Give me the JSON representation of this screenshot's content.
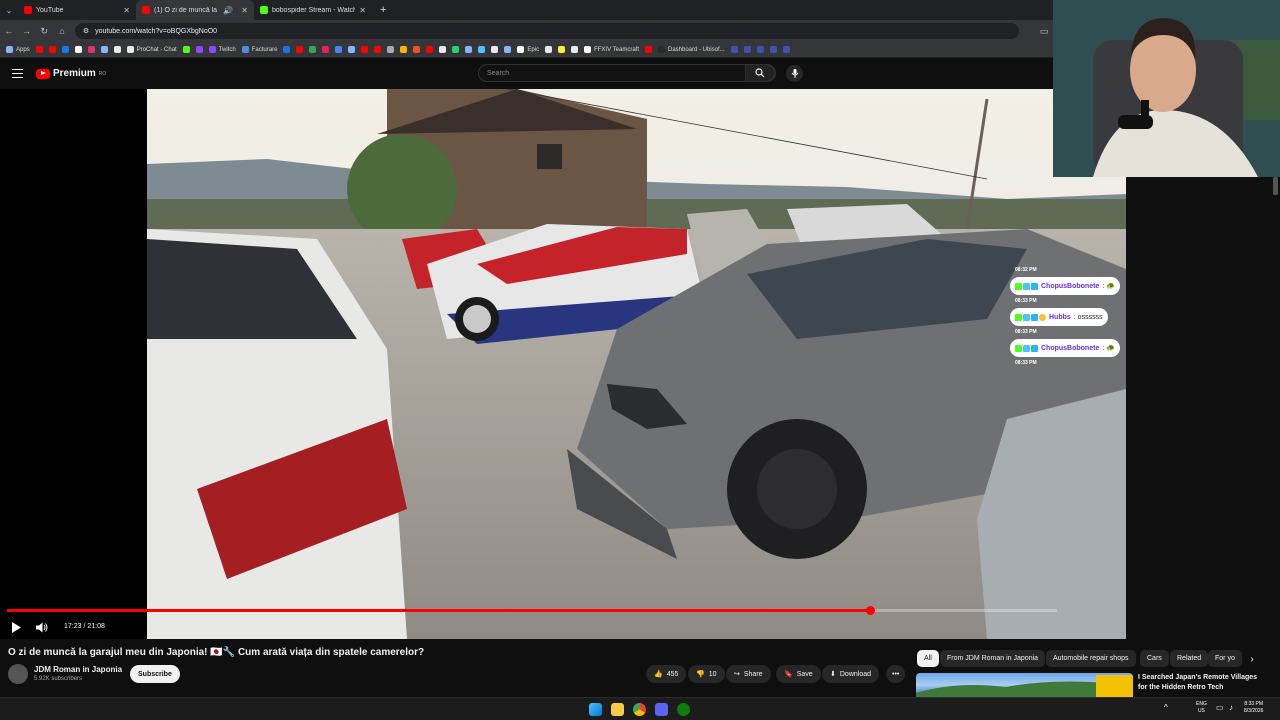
{
  "browser": {
    "tabs": [
      {
        "label": "YouTube",
        "active": false,
        "favicon_color": "#ff0000"
      },
      {
        "label": "(1) O zi de muncă la garajul",
        "active": true,
        "favicon_color": "#ff0000"
      },
      {
        "label": "bobospider Stream - Watch Liv",
        "active": false,
        "favicon_color": "#53fc18"
      }
    ],
    "url": "youtube.com/watch?v=oBQGXbgNoO0",
    "bookmarks": [
      {
        "label": "Apps",
        "color": "#8ab4f8"
      },
      {
        "label": "",
        "color": "#ff0000"
      },
      {
        "label": "",
        "color": "#ff0000"
      },
      {
        "label": "",
        "color": "#1877f2"
      },
      {
        "label": "",
        "color": "#ffffff"
      },
      {
        "label": "",
        "color": "#e1306c"
      },
      {
        "label": "",
        "color": "#8ab4f8"
      },
      {
        "label": "ProChat - Chat",
        "color": "#e8eaed"
      },
      {
        "label": "",
        "color": "#53fc18"
      },
      {
        "label": "Twitch",
        "color": "#9146ff"
      },
      {
        "label": "Facturare",
        "color": "#4a90e2"
      },
      {
        "label": "",
        "color": "#1a73e8"
      },
      {
        "label": "",
        "color": "#ff0000"
      },
      {
        "label": "Epic",
        "color": "#ffffff"
      },
      {
        "label": "FFXIV Teamcraft",
        "color": "#ffffff"
      },
      {
        "label": "Dashboard - Ubisof...",
        "color": "#ffffff"
      }
    ]
  },
  "youtube": {
    "logo_text": "Premium",
    "logo_sup": "RO",
    "search_placeholder": "Search"
  },
  "player": {
    "current_time": "17:23",
    "duration": "21:08",
    "time_display": "17:23 / 21:08",
    "progress_fraction": 0.822
  },
  "chat": {
    "messages": [
      {
        "time": "08:32 PM",
        "user": "ChopusBobonete",
        "text": ": 🐢",
        "user_color": "#6a2fd6"
      },
      {
        "time": "08:33 PM",
        "user": "Hubbs",
        "text": ": ossssss",
        "user_color": "#6a2fd6"
      },
      {
        "time": "08:33 PM",
        "user": "ChopusBobonete",
        "text": ": 🐢",
        "user_color": "#6a2fd6"
      }
    ],
    "trailing_time": "08:33 PM"
  },
  "video": {
    "title": "O zi de muncă la garajul meu din Japonia! 🇯🇵🔧 Cum arată viața din spatele camerelor?",
    "channel": "JDM Roman in Japonia",
    "subscribers": "5.92K subscribers",
    "subscribe_label": "Subscribe",
    "likes": "455",
    "dislikes": "10",
    "share_label": "Share",
    "save_label": "Save",
    "download_label": "Download",
    "more_label": "•••"
  },
  "chips": [
    "All",
    "From JDM Roman in Japonia",
    "Automobile repair shops",
    "Cars",
    "Related",
    "For yo"
  ],
  "recommended": {
    "title": "I Searched Japan's Remote Villages for the Hidden Retro Tech"
  },
  "taskbar": {
    "lang": "ENG",
    "region": "US",
    "time": "8:33 PM",
    "date": "8/3/2026"
  }
}
